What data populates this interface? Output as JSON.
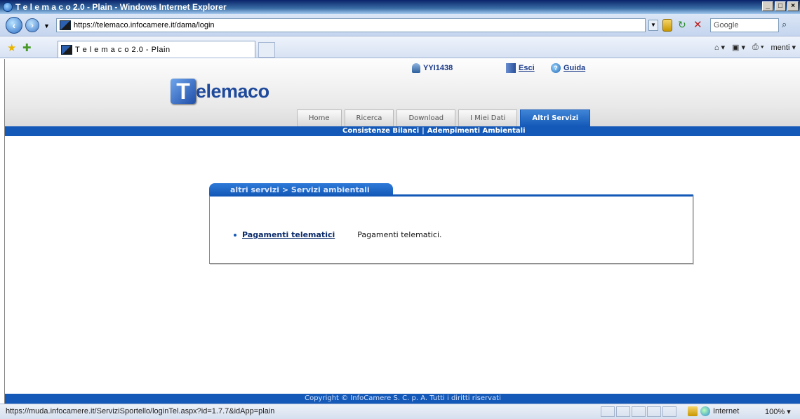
{
  "window": {
    "title": "T e l e m a c o 2.0 - Plain - Windows Internet Explorer",
    "minimize": "_",
    "maximize": "□",
    "close": "×"
  },
  "browser": {
    "address": "https://telemaco.infocamere.it/dama/login",
    "search_placeholder": "Google",
    "tab_title": "T e l e m a c o 2.0 - Plain",
    "command_bar": {
      "page": "menti"
    }
  },
  "header": {
    "user": "YYI1438",
    "exit": "Esci",
    "help": "Guida",
    "logo_letter": "T",
    "logo_text": "elemaco"
  },
  "nav": {
    "tabs": [
      {
        "label": "Home"
      },
      {
        "label": "Ricerca"
      },
      {
        "label": "Download"
      },
      {
        "label": "I Miei Dati"
      },
      {
        "label": "Altri Servizi"
      }
    ],
    "subitems": [
      {
        "label": "Consistenze Bilanci"
      },
      {
        "label": "Adempimenti Ambientali"
      }
    ],
    "separator": "|"
  },
  "content": {
    "breadcrumb": "altri servizi > Servizi ambientali",
    "items": [
      {
        "link": "Pagamenti telematici",
        "description": "Pagamenti telematici."
      }
    ]
  },
  "footer": {
    "copyright": "Copyright © InfoCamere S. C. p. A. Tutti i diritti riservati"
  },
  "status": {
    "url": "https://muda.infocamere.it/ServiziSportello/loginTel.aspx?id=1.7.7&idApp=plain",
    "zone": "Internet",
    "zoom": "100%"
  }
}
